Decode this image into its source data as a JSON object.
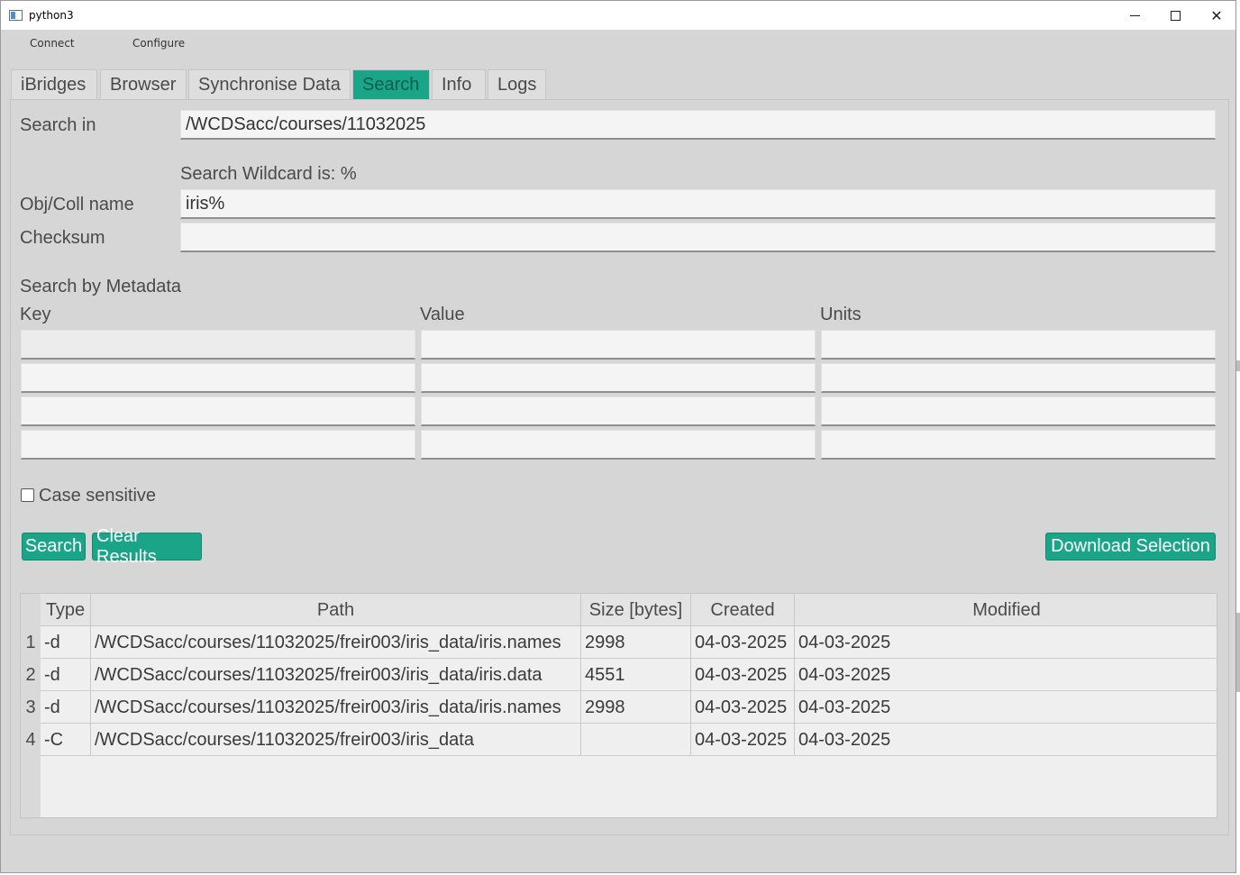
{
  "window": {
    "title": "python3"
  },
  "menu": [
    {
      "label": "Connect"
    },
    {
      "label": "Configure"
    }
  ],
  "tabs": [
    {
      "label": "iBridges",
      "active": false
    },
    {
      "label": "Browser",
      "active": false
    },
    {
      "label": "Synchronise Data",
      "active": false
    },
    {
      "label": "Search",
      "active": true
    },
    {
      "label": "Info",
      "active": false
    },
    {
      "label": "Logs",
      "active": false
    }
  ],
  "search": {
    "search_in_label": "Search in",
    "search_in_value": "/WCDSacc/courses/11032025",
    "wildcard_note": "Search Wildcard is: %",
    "name_label": "Obj/Coll name",
    "name_value": "iris%",
    "checksum_label": "Checksum",
    "checksum_value": ""
  },
  "metadata": {
    "title": "Search by Metadata",
    "headers": {
      "key": "Key",
      "value": "Value",
      "units": "Units"
    },
    "rows": [
      {
        "key": "",
        "value": "",
        "units": ""
      },
      {
        "key": "",
        "value": "",
        "units": ""
      },
      {
        "key": "",
        "value": "",
        "units": ""
      },
      {
        "key": "",
        "value": "",
        "units": ""
      }
    ]
  },
  "options": {
    "case_sensitive_label": "Case sensitive",
    "case_sensitive": false
  },
  "buttons": {
    "search": "Search",
    "clear": "Clear Results",
    "download": "Download Selection"
  },
  "results": {
    "columns": [
      "Type",
      "Path",
      "Size [bytes]",
      "Created",
      "Modified"
    ],
    "rows": [
      {
        "num": "1",
        "type": "-d",
        "path": "/WCDSacc/courses/11032025/freir003/iris_data/iris.names",
        "size": "2998",
        "created": "04-03-2025",
        "modified": "04-03-2025"
      },
      {
        "num": "2",
        "type": "-d",
        "path": "/WCDSacc/courses/11032025/freir003/iris_data/iris.data",
        "size": "4551",
        "created": "04-03-2025",
        "modified": "04-03-2025"
      },
      {
        "num": "3",
        "type": "-d",
        "path": "/WCDSacc/courses/11032025/freir003/iris_data/iris.names",
        "size": "2998",
        "created": "04-03-2025",
        "modified": "04-03-2025"
      },
      {
        "num": "4",
        "type": "-C",
        "path": "/WCDSacc/courses/11032025/freir003/iris_data",
        "size": "",
        "created": "04-03-2025",
        "modified": "04-03-2025"
      }
    ]
  },
  "colors": {
    "accent": "#1aa589",
    "background": "#d6d6d6"
  }
}
